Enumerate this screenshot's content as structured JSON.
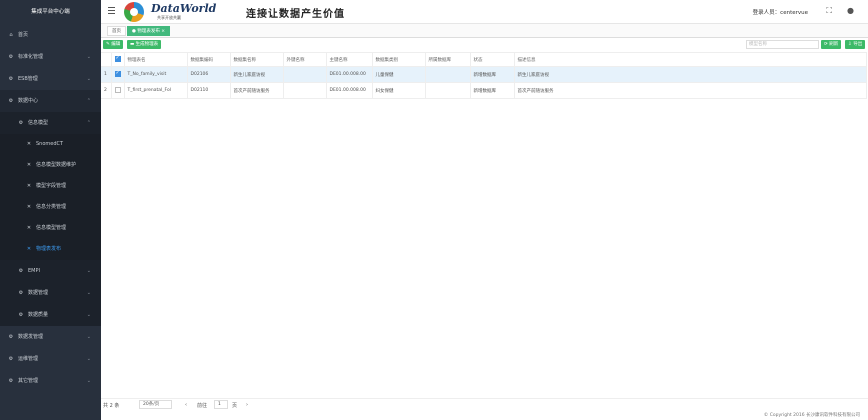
{
  "sidebar": {
    "title": "集成平台中心端",
    "items": [
      {
        "label": "首页",
        "icon": "home-icon",
        "glyph": "⌂",
        "chevron": ""
      },
      {
        "label": "标准化管理",
        "icon": "gear-icon",
        "glyph": "⚙",
        "chevron": "⌄"
      },
      {
        "label": "ESB管理",
        "icon": "gear-icon",
        "glyph": "⚙",
        "chevron": "⌄"
      },
      {
        "label": "数据中心",
        "icon": "gear-icon",
        "glyph": "⚙",
        "chevron": "⌃"
      },
      {
        "label": "信息模型",
        "icon": "gear-icon",
        "glyph": "⚙",
        "chevron": "⌃"
      },
      {
        "label": "SnomedCT",
        "icon": "tool-icon",
        "glyph": "✕",
        "chevron": ""
      },
      {
        "label": "信息模型数据维护",
        "icon": "tool-icon",
        "glyph": "✕",
        "chevron": ""
      },
      {
        "label": "模型字段管理",
        "icon": "tool-icon",
        "glyph": "✕",
        "chevron": ""
      },
      {
        "label": "信息分类管理",
        "icon": "tool-icon",
        "glyph": "✕",
        "chevron": ""
      },
      {
        "label": "信息模型管理",
        "icon": "tool-icon",
        "glyph": "✕",
        "chevron": ""
      },
      {
        "label": "物理表发布",
        "icon": "tool-icon",
        "glyph": "✕",
        "chevron": ""
      },
      {
        "label": "EMPI",
        "icon": "gear-icon",
        "glyph": "⚙",
        "chevron": "⌄"
      },
      {
        "label": "数据管理",
        "icon": "gear-icon",
        "glyph": "⚙",
        "chevron": "⌄"
      },
      {
        "label": "数据质量",
        "icon": "gear-icon",
        "glyph": "⚙",
        "chevron": "⌄"
      },
      {
        "label": "数据发管理",
        "icon": "gear-icon",
        "glyph": "⚙",
        "chevron": "⌄"
      },
      {
        "label": "运维管理",
        "icon": "gear-icon",
        "glyph": "⚙",
        "chevron": "⌄"
      },
      {
        "label": "其它管理",
        "icon": "gear-icon",
        "glyph": "⚙",
        "chevron": "⌄"
      }
    ]
  },
  "header": {
    "brand": "DataWorld",
    "brand_sub": "共享开放共赢",
    "slogan": "连接让数据产生价值",
    "login_label": "登录人员：centervue",
    "fullscreen_glyph": "⛶",
    "user_glyph": "●"
  },
  "tabs": [
    {
      "label": "首页"
    },
    {
      "label": "● 物理表发布 ×"
    }
  ],
  "toolbar": {
    "edit_label": "✎ 编辑",
    "generate_label": "▬ 生成物理表",
    "search_placeholder": "模型名称",
    "refresh_label": "⟳ 刷新",
    "export_label": "⇩ 导出"
  },
  "table": {
    "columns": [
      "物理表名",
      "数据集编码",
      "数据集名称",
      "外键名称",
      "主键名称",
      "数据集类别",
      "所属数据库",
      "状态",
      "描述信息"
    ],
    "rows": [
      {
        "index": "1",
        "checked": true,
        "cells": [
          "T_No_family_visit",
          "D02106",
          "新生儿家庭访视",
          "",
          "DE01.00.008.00",
          "儿童保健",
          "",
          "新增数据库",
          "新生儿家庭访视"
        ]
      },
      {
        "index": "2",
        "checked": false,
        "cells": [
          "T_first_prenatal_Fol",
          "D02110",
          "首次产前随访服务",
          "",
          "DE01.00.008.00",
          "妇女保健",
          "",
          "新增数据库",
          "首次产前随访服务"
        ]
      }
    ]
  },
  "pager": {
    "total": "共 2 条",
    "page_size": "20条/页",
    "prev_glyph": "‹",
    "goto_label": "前往",
    "page": "1",
    "page_suffix": "页",
    "next_glyph": "›"
  },
  "footer": {
    "copyright": "© Copyright 2016 长沙康讯软件科技有限公司"
  }
}
